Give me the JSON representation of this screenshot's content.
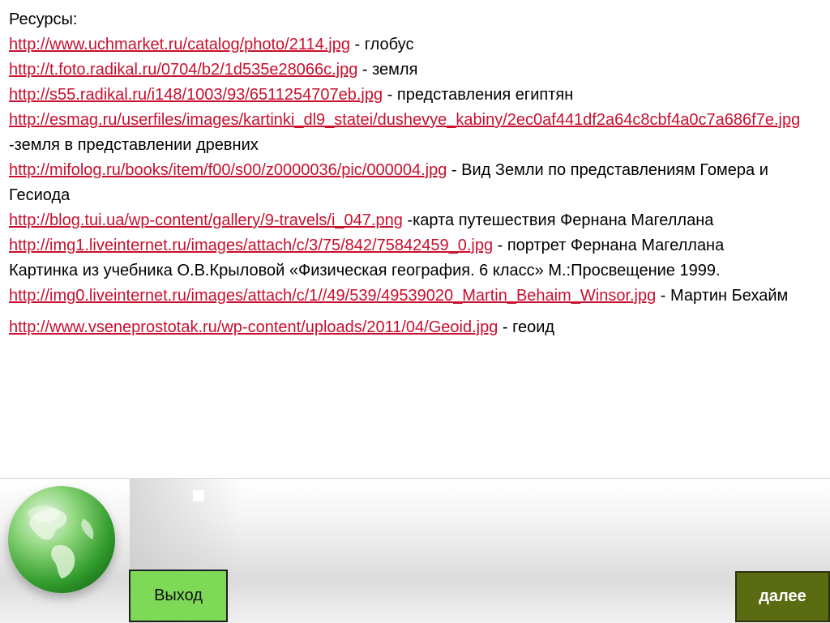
{
  "resources": {
    "heading": "Ресурсы:",
    "items": [
      {
        "url": "http://www.uchmarket.ru/catalog/photo/2114.jpg",
        "desc": " - глобус"
      },
      {
        "url": "http://t.foto.radikal.ru/0704/b2/1d535e28066c.jpg",
        "desc": " - земля"
      },
      {
        "url": "http://s55.radikal.ru/i148/1003/93/6511254707eb.jpg",
        "desc": " - представления египтян"
      },
      {
        "url": "http://esmag.ru/userfiles/images/kartinki_dl9_statei/dushevye_kabiny/2ec0af441df2a64c8cbf4a0c7a686f7e.jpg",
        "desc": " -земля в представлении древних"
      },
      {
        "url": "http://mifolog.ru/books/item/f00/s00/z0000036/pic/000004.jpg",
        "desc": " -  Вид Земли по представлениям Гомера и Гесиода"
      },
      {
        "url": "http://blog.tui.ua/wp-content/gallery/9-travels/i_047.png",
        "desc": " -карта путешествия Фернана Магеллана"
      },
      {
        "url": "http://img1.liveinternet.ru/images/attach/c/3/75/842/75842459_0.jpg",
        "desc": " - портрет Фернана Магеллана"
      }
    ],
    "textbook_note": "Картинка из учебника О.В.Крыловой «Физическая география. 6 класс» М.:Просвещение 1999.",
    "items_after": [
      {
        "url": "http://img0.liveinternet.ru/images/attach/c/1//49/539/49539020_Martin_Behaim_Winsor.jpg",
        "desc": " - Мартин Бехайм"
      }
    ],
    "last_item": {
      "url": "http://www.vseneprostotak.ru/wp-content/uploads/2011/04/Geoid.jpg",
      "desc": "  - геоид"
    }
  },
  "buttons": {
    "exit_label": "Выход",
    "next_label": "далее"
  },
  "colors": {
    "link": "#c8102e",
    "exit_button_bg": "#7ed957",
    "next_button_bg": "#5a6b12"
  }
}
